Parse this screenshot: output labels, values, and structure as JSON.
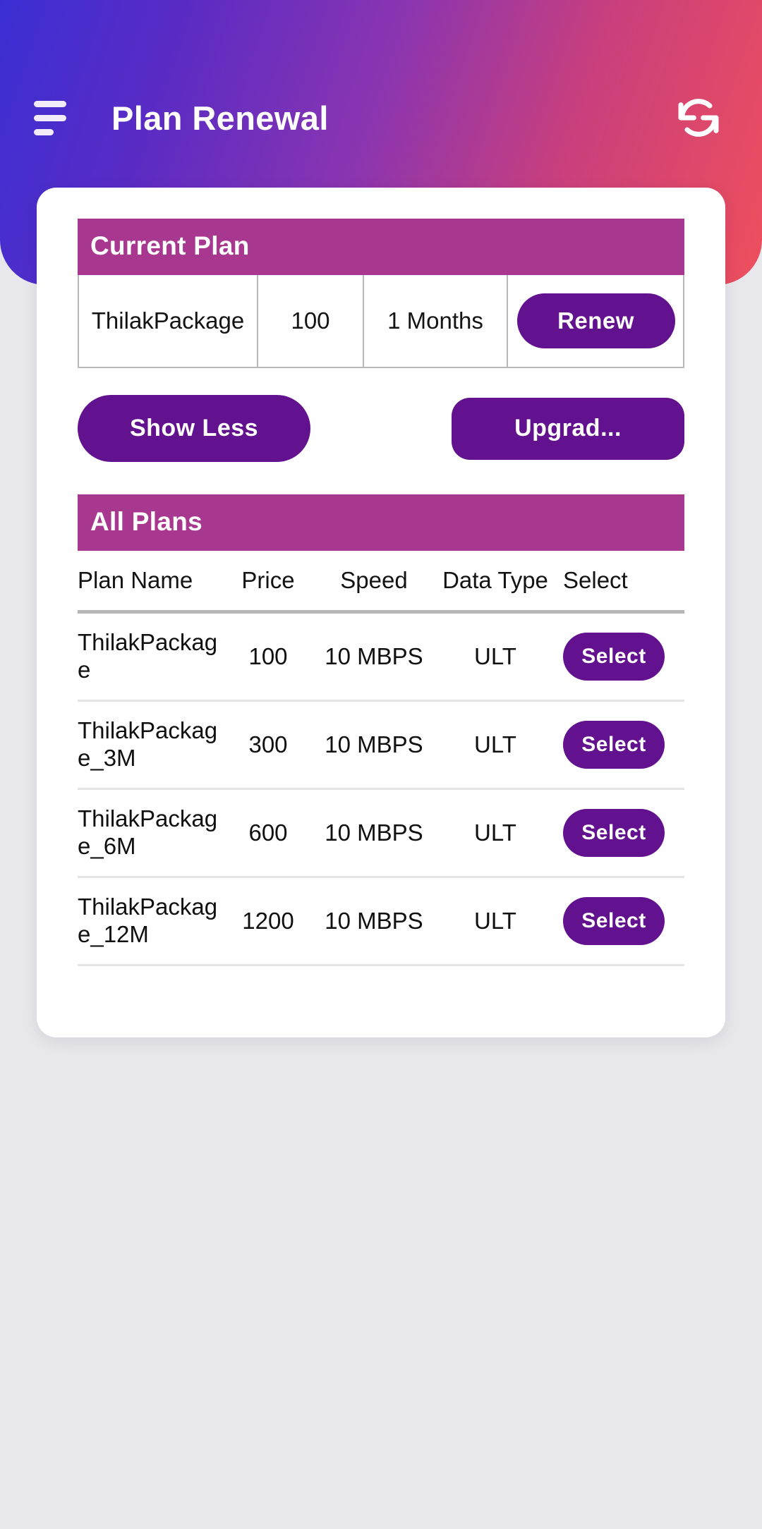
{
  "appbar": {
    "title": "Plan Renewal",
    "menu_icon": "hamburger-menu-icon",
    "refresh_icon": "refresh-sync-icon",
    "gradient_start": "#3b2fd4",
    "gradient_end": "#ee4f5c"
  },
  "theme": {
    "banner_bg": "#a8378f",
    "button_purple": "#63128f",
    "page_bg": "#e8e8ec",
    "card_bg": "#ffffff"
  },
  "current_plan": {
    "banner": "Current Plan",
    "plan_name": "ThilakPackage",
    "price": "100",
    "duration": "1 Months",
    "renew_label": "Renew"
  },
  "actions": {
    "show_less_label": "Show Less",
    "upgrade_label": "Upgrad..."
  },
  "all_plans": {
    "banner": "All Plans",
    "columns": [
      "Plan Name",
      "Price",
      "Speed",
      "Data Type",
      "Select"
    ],
    "rows": [
      {
        "name": "ThilakPackage",
        "price": "100",
        "speed": "10 MBPS",
        "type": "ULT",
        "select_label": "Select"
      },
      {
        "name": "ThilakPackage_3M",
        "price": "300",
        "speed": "10 MBPS",
        "type": "ULT",
        "select_label": "Select"
      },
      {
        "name": "ThilakPackage_6M",
        "price": "600",
        "speed": "10 MBPS",
        "type": "ULT",
        "select_label": "Select"
      },
      {
        "name": "ThilakPackage_12M",
        "price": "1200",
        "speed": "10 MBPS",
        "type": "ULT",
        "select_label": "Select"
      }
    ]
  }
}
